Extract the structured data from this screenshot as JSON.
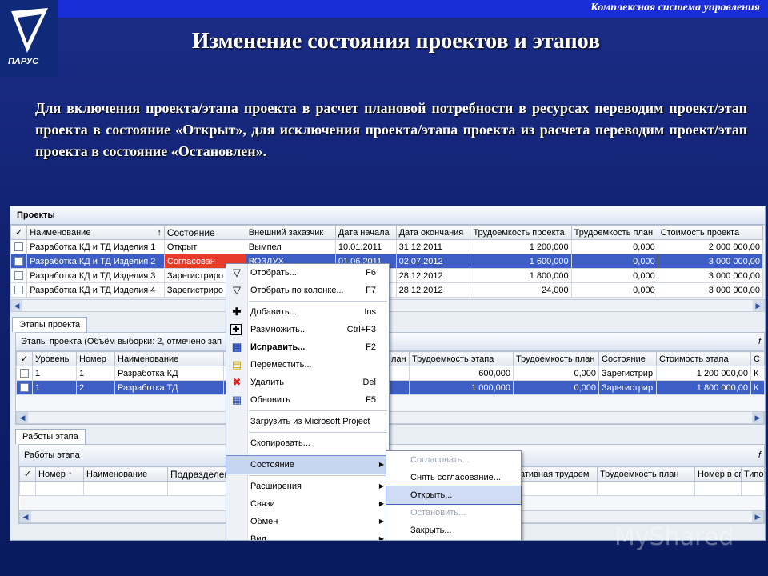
{
  "header": {
    "system_name": "Комплексная система управления",
    "logo_text": "ПАРУС",
    "title": "Изменение состояния проектов и этапов",
    "intro": "Для включения проекта/этапа проекта в расчет плановой потребности в ресурсах переводим проект/этап проекта в состояние «Открыт», для исключения проекта/этапа проекта из расчета переводим проект/этап проекта в состояние «Остановлен»."
  },
  "projects": {
    "title": "Проекты",
    "columns": [
      "Наименование",
      "Состояние",
      "Внешний заказчик",
      "Дата начала",
      "Дата окончания",
      "Трудоемкость проекта",
      "Трудоемкость план",
      "Стоимость проекта"
    ],
    "rows": [
      {
        "name": "Разработка КД и ТД Изделия 1",
        "state": "Открыт",
        "customer": "Вымпел",
        "start": "10.01.2011",
        "end": "31.12.2011",
        "labor": "1 200,000",
        "labor_plan": "0,000",
        "cost": "2 000 000,00"
      },
      {
        "name": "Разработка КД и ТД Изделия 2",
        "state": "Согласован",
        "customer": "ВОЗДУХ",
        "start": "01.06.2011",
        "end": "02.07.2012",
        "labor": "1 600,000",
        "labor_plan": "0,000",
        "cost": "3 000 000,00"
      },
      {
        "name": "Разработка КД и ТД Изделия 3",
        "state": "Зарегистриро",
        "customer": "",
        "start": "",
        "end": "28.12.2012",
        "labor": "1 800,000",
        "labor_plan": "0,000",
        "cost": "3 000 000,00"
      },
      {
        "name": "Разработка КД и ТД Изделия 4",
        "state": "Зарегистриро",
        "customer": "",
        "start": "",
        "end": "28.12.2012",
        "labor": "24,000",
        "labor_plan": "0,000",
        "cost": "3 000 000,00"
      }
    ]
  },
  "stages": {
    "tab": "Этапы проекта",
    "header": "Этапы проекта (Объём выборки: 2, отмечено зап",
    "columns": [
      "Уровень",
      "Номер",
      "Наименование",
      "лан",
      "Трудоемкость этапа",
      "Трудоемкость план",
      "Состояние",
      "Стоимость этапа",
      "С"
    ],
    "rows": [
      {
        "level": "1",
        "num": "1",
        "name": "Разработка КД",
        "labor": "600,000",
        "labor_plan": "0,000",
        "state": "Зарегистрир",
        "cost": "1 200 000,00",
        "c": "К"
      },
      {
        "level": "1",
        "num": "2",
        "name": "Разработка ТД",
        "labor": "1 000,000",
        "labor_plan": "0,000",
        "state": "Зарегистрир",
        "cost": "1 800 000,00",
        "c": "К"
      }
    ]
  },
  "works": {
    "tab": "Работы этапа",
    "header": "Работы этапа",
    "columns": [
      "Номер",
      "Наименование",
      "Подразделен",
      "ативная трудоем",
      "Трудоемкость план",
      "Номер в сп",
      "Типо"
    ]
  },
  "context_menu": [
    {
      "label": "Отобрать...",
      "shortcut": "F6",
      "icon": "filter-icon"
    },
    {
      "label": "Отобрать по колонке...",
      "shortcut": "F7",
      "icon": "column-filter-icon"
    },
    {
      "sep": true
    },
    {
      "label": "Добавить...",
      "shortcut": "Ins",
      "icon": "add-icon"
    },
    {
      "label": "Размножить...",
      "shortcut": "Ctrl+F3",
      "icon": "duplicate-icon"
    },
    {
      "label": "Исправить...",
      "shortcut": "F2",
      "icon": "edit-icon",
      "bold": true
    },
    {
      "label": "Переместить...",
      "shortcut": "",
      "icon": "move-icon"
    },
    {
      "label": "Удалить",
      "shortcut": "Del",
      "icon": "delete-icon"
    },
    {
      "label": "Обновить",
      "shortcut": "F5",
      "icon": "refresh-icon"
    },
    {
      "sep": true
    },
    {
      "label": "Загрузить из Microsoft Project",
      "shortcut": ""
    },
    {
      "sep": true
    },
    {
      "label": "Скопировать...",
      "shortcut": ""
    },
    {
      "sep": true
    },
    {
      "label": "Состояние",
      "submenu": true,
      "highlight": true
    },
    {
      "sep": true
    },
    {
      "label": "Расширения",
      "submenu": true
    },
    {
      "label": "Связи",
      "submenu": true
    },
    {
      "label": "Обмен",
      "submenu": true
    },
    {
      "label": "Вид",
      "submenu": true
    }
  ],
  "state_submenu": [
    {
      "label": "Согласовать...",
      "disabled": true
    },
    {
      "label": "Снять согласование...",
      "disabled": false
    },
    {
      "label": "Открыть...",
      "disabled": false,
      "highlight": true
    },
    {
      "label": "Остановить...",
      "disabled": true
    },
    {
      "label": "Закрыть...",
      "disabled": false
    }
  ],
  "watermark": "MyShared",
  "colors": {
    "selected_row": "#3d5ec4",
    "state_red": "#e83b2c",
    "menu_highlight": "#c6d6f0"
  }
}
